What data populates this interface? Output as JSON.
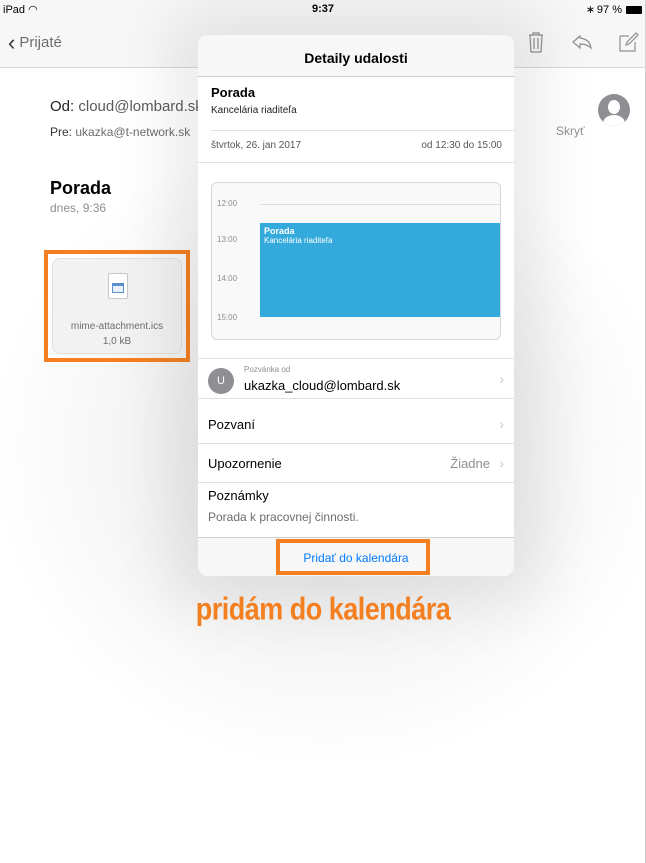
{
  "status": {
    "device": "iPad",
    "time": "9:37",
    "battery": "97 %"
  },
  "nav": {
    "back_label": "Prijaté"
  },
  "mail": {
    "from_label": "Od:",
    "from_addr": "cloud@lombard.sk",
    "to_label": "Pre:",
    "to_addr": "ukazka@t-network.sk",
    "hide": "Skryť",
    "subject": "Porada",
    "date": "dnes, 9:36",
    "attachment": {
      "name": "mime-attachment.ics",
      "size": "1,0 kB"
    }
  },
  "modal": {
    "title": "Detaily udalosti",
    "event_title": "Porada",
    "event_location": "Kancelária riaditeľa",
    "day": "štvrtok, 26. jan 2017",
    "time_range": "od 12:30 do 15:00",
    "calendar": {
      "hours": [
        "12:00",
        "13:00",
        "14:00",
        "15:00"
      ],
      "event_title": "Porada",
      "event_location": "Kancelária riaditeľa"
    },
    "inviter_initial": "U",
    "inviter_label": "Pozvánka od",
    "inviter_addr": "ukazka_cloud@lombard.sk",
    "invited_label": "Pozvaní",
    "alert_label": "Upozornenie",
    "alert_value": "Žiadne",
    "notes_label": "Poznámky",
    "notes_text": "Porada k pracovnej činnosti.",
    "add_button": "Pridať do kalendára"
  },
  "caption": "pridám do kalendára",
  "colors": {
    "accent": "#f47f20",
    "link": "#007aff",
    "event": "#34aadc"
  }
}
